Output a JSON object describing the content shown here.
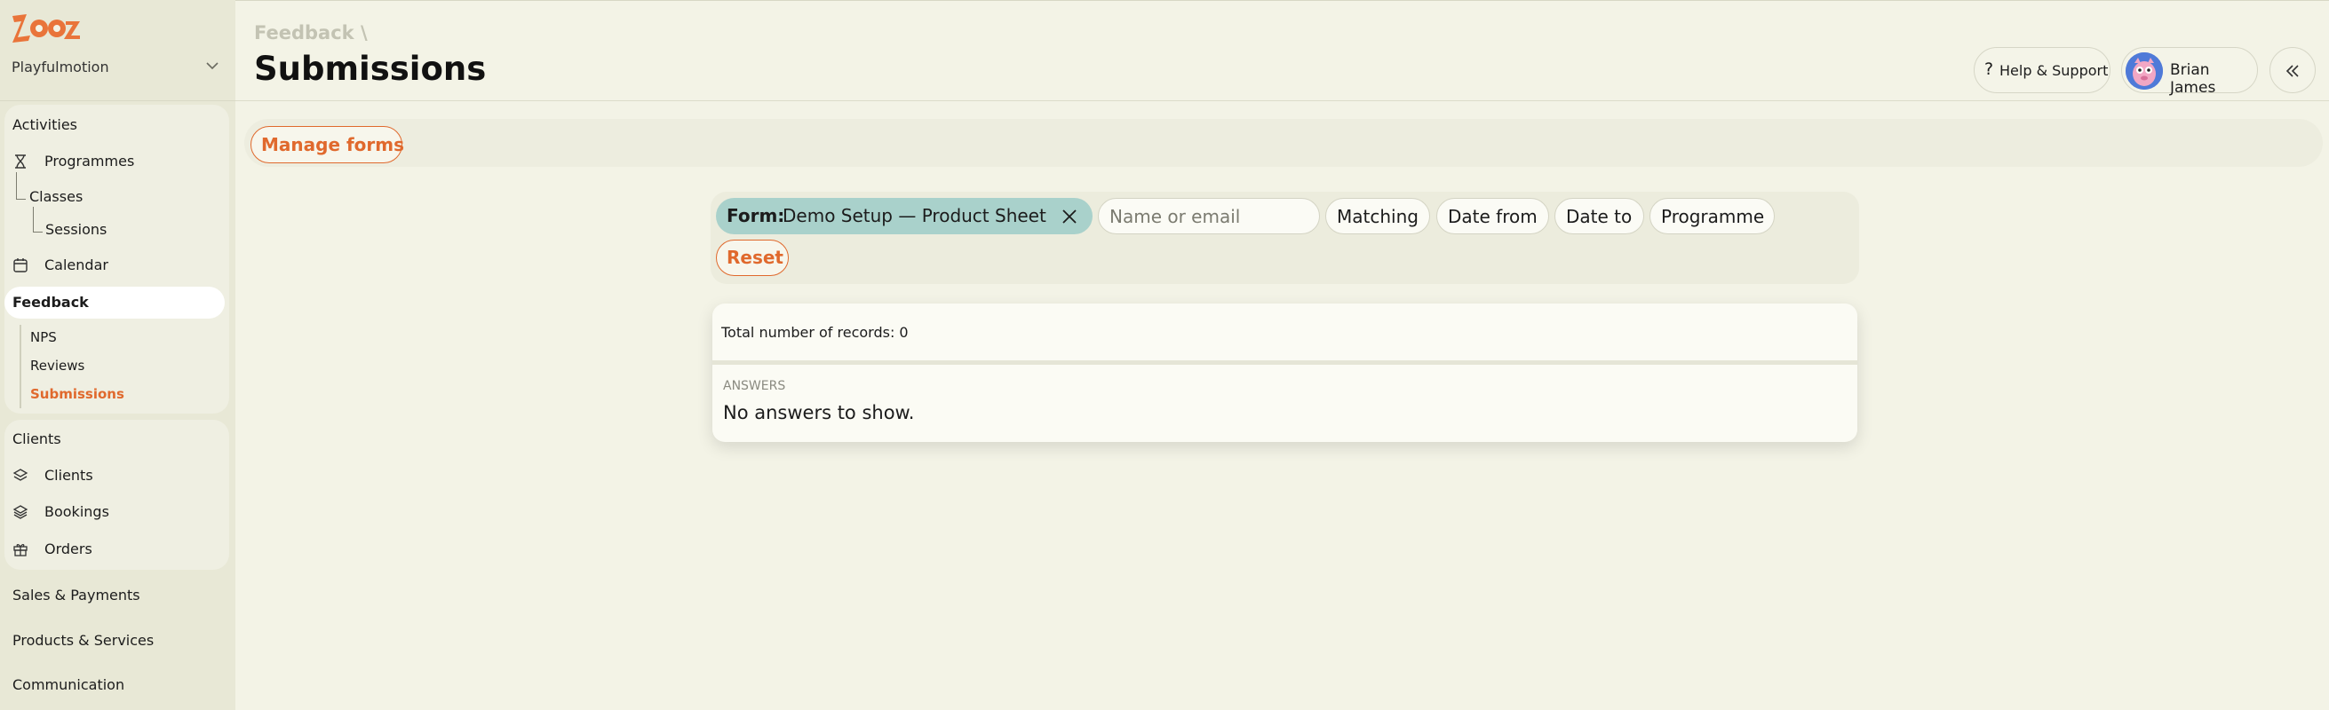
{
  "app": {
    "brand": "Zooza",
    "account_name": "Playfulmotion"
  },
  "sidebar": {
    "activities_title": "Activities",
    "programmes": "Programmes",
    "classes": "Classes",
    "sessions": "Sessions",
    "calendar": "Calendar",
    "feedback_title": "Feedback",
    "nps": "NPS",
    "reviews": "Reviews",
    "submissions": "Submissions",
    "clients_title": "Clients",
    "clients": "Clients",
    "bookings": "Bookings",
    "orders": "Orders",
    "sales_payments": "Sales & Payments",
    "products_services": "Products & Services",
    "communication": "Communication"
  },
  "header": {
    "breadcrumb": "Feedback \\",
    "title": "Submissions",
    "help_label": "Help & Support",
    "user_name": "Brian James"
  },
  "toolbar": {
    "manage_forms_label": "Manage forms"
  },
  "filters": {
    "form_label": "Form:",
    "form_value": "Demo Setup — Product Sheet",
    "search_placeholder": "Name or email",
    "matching": "Matching",
    "date_from": "Date from",
    "date_to": "Date to",
    "programme": "Programme",
    "reset": "Reset"
  },
  "results": {
    "total_records": "Total number of records: 0",
    "answers_label": "ANSWERS",
    "empty_message": "No answers to show."
  },
  "colors": {
    "accent": "#e0692d",
    "chip_teal": "#a9d1cb",
    "background": "#f3f3e6"
  }
}
